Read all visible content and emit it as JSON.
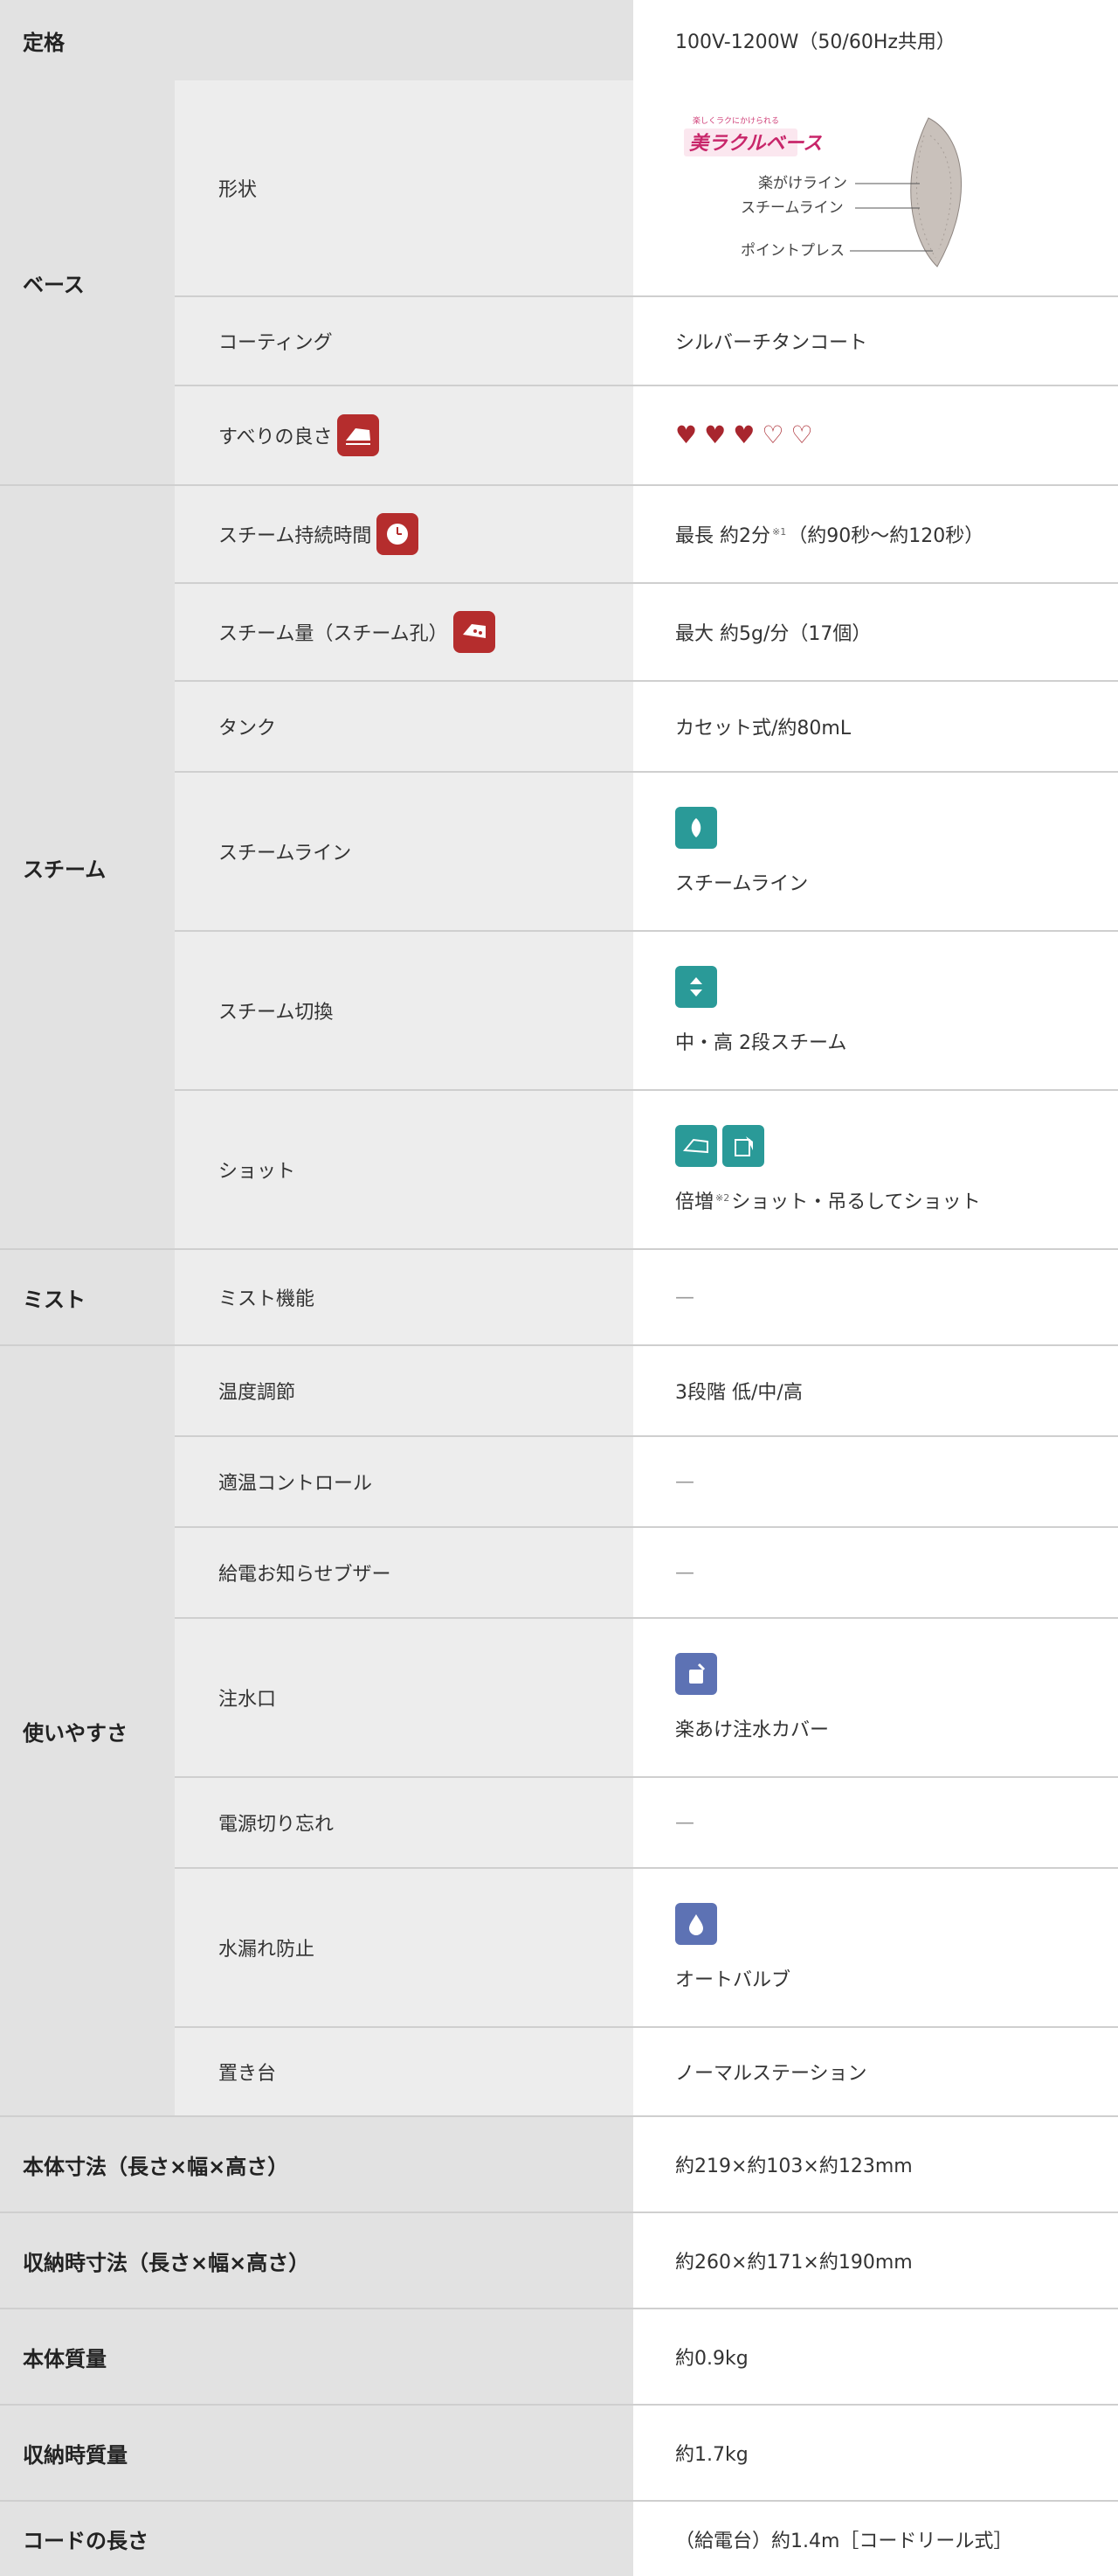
{
  "rating": {
    "category": "定格",
    "value": "100V-1200W（50/60Hz共用）"
  },
  "base": {
    "category": "ベース",
    "shape": {
      "label": "形状",
      "brand": "美ラクルベース",
      "brand_tagline": "楽しくラクにかけられる",
      "callouts": [
        "楽がけライン",
        "スチームライン",
        "ポイントプレス"
      ]
    },
    "coating": {
      "label": "コーティング",
      "value": "シルバーチタンコート"
    },
    "glide": {
      "label": "すべりの良さ",
      "rating": 3,
      "max": 5
    }
  },
  "steam": {
    "category": "スチーム",
    "duration": {
      "label": "スチーム持続時間",
      "value_main": "最長 約2分",
      "footnote": "※1",
      "value_detail": "（約90秒〜約120秒）"
    },
    "amount": {
      "label": "スチーム量（スチーム孔）",
      "value": "最大 約5g/分（17個）"
    },
    "tank": {
      "label": "タンク",
      "value": "カセット式/約80mL"
    },
    "line": {
      "label": "スチームライン",
      "value": "スチームライン"
    },
    "switch": {
      "label": "スチーム切換",
      "value": "中・高 2段スチーム"
    },
    "shot": {
      "label": "ショット",
      "value_prefix": "倍増",
      "footnote": "※2",
      "value_suffix": "ショット・吊るしてショット"
    }
  },
  "mist": {
    "category": "ミスト",
    "function": {
      "label": "ミスト機能",
      "value": "—"
    }
  },
  "usability": {
    "category": "使いやすさ",
    "temp": {
      "label": "温度調節",
      "value": "3段階 低/中/高"
    },
    "auto_temp": {
      "label": "適温コントロール",
      "value": "—"
    },
    "buzzer": {
      "label": "給電お知らせブザー",
      "value": "—"
    },
    "inlet": {
      "label": "注水口",
      "value": "楽あけ注水カバー"
    },
    "auto_off": {
      "label": "電源切り忘れ",
      "value": "—"
    },
    "leak": {
      "label": "水漏れ防止",
      "value": "オートバルブ"
    },
    "stand": {
      "label": "置き台",
      "value": "ノーマルステーション"
    }
  },
  "body_dims": {
    "category": "本体寸法（長さ×幅×高さ）",
    "value": "約219×約103×約123mm"
  },
  "storage_dims": {
    "category": "収納時寸法（長さ×幅×高さ）",
    "value": "約260×約171×約190mm"
  },
  "body_mass": {
    "category": "本体質量",
    "value": "約0.9kg"
  },
  "storage_mass": {
    "category": "収納時質量",
    "value": "約1.7kg"
  },
  "cord": {
    "category": "コードの長さ",
    "value": "（給電台）約1.4m［コードリール式］"
  },
  "colors": {
    "category_bg": "#e2e2e2",
    "sub_bg": "#ededed",
    "teal": "#2a9a98",
    "blue": "#5d72b4",
    "red": "#b52d2d",
    "heart": "#a8262e"
  }
}
